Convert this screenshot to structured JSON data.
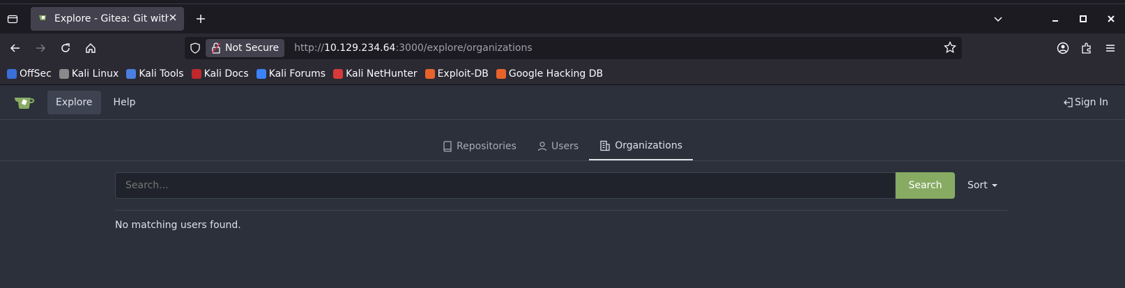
{
  "browser": {
    "tab_title": "Explore - Gitea: Git with a",
    "security_label": "Not Secure",
    "url_prefix": "http://",
    "url_host": "10.129.234.64",
    "url_rest": ":3000/explore/organizations"
  },
  "bookmarks": [
    {
      "label": "OffSec",
      "color": "#3a6fd8"
    },
    {
      "label": "Kali Linux",
      "color": "#8a8a8a"
    },
    {
      "label": "Kali Tools",
      "color": "#4a7fe0"
    },
    {
      "label": "Kali Docs",
      "color": "#c0282c"
    },
    {
      "label": "Kali Forums",
      "color": "#3b82f6"
    },
    {
      "label": "Kali NetHunter",
      "color": "#d83a3a"
    },
    {
      "label": "Exploit-DB",
      "color": "#e8632b"
    },
    {
      "label": "Google Hacking DB",
      "color": "#e8632b"
    }
  ],
  "gitea": {
    "nav_explore": "Explore",
    "nav_help": "Help",
    "sign_in": "Sign In",
    "tabs": {
      "repositories": "Repositories",
      "users": "Users",
      "organizations": "Organizations"
    },
    "search_placeholder": "Search...",
    "search_button": "Search",
    "sort_label": "Sort",
    "empty_message": "No matching users found.",
    "accent_color": "#87ab63"
  }
}
